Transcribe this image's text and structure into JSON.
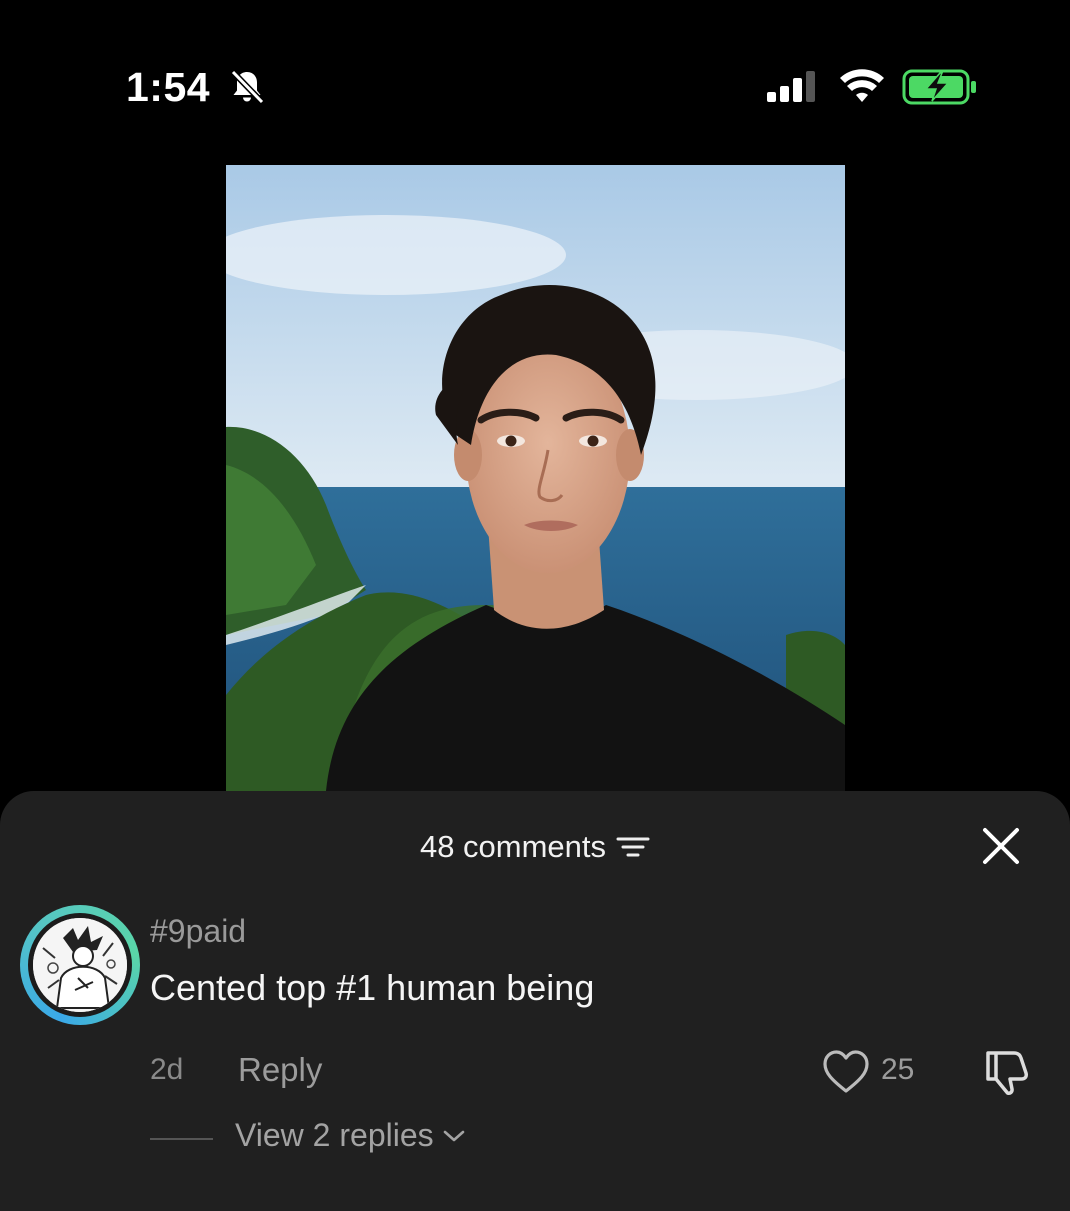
{
  "status_bar": {
    "time": "1:54",
    "icons": [
      "bell-slash-icon",
      "signal-icon",
      "wifi-icon",
      "battery-charging-icon"
    ],
    "battery_color": "#4cd964"
  },
  "post": {
    "image_description_icon": "portrait-photo"
  },
  "comments_sheet": {
    "count_label": "48 comments",
    "sort_icon": "sort-lines-icon",
    "close_icon": "close-icon",
    "comments": [
      {
        "username": "#9paid",
        "text": "Cented top #1 human being",
        "time": "2d",
        "reply_label": "Reply",
        "likes": "25",
        "view_replies_label": "View 2 replies"
      }
    ]
  },
  "colors": {
    "sheet_background": "#202020",
    "avatar_ring": "#3aa8e8"
  }
}
